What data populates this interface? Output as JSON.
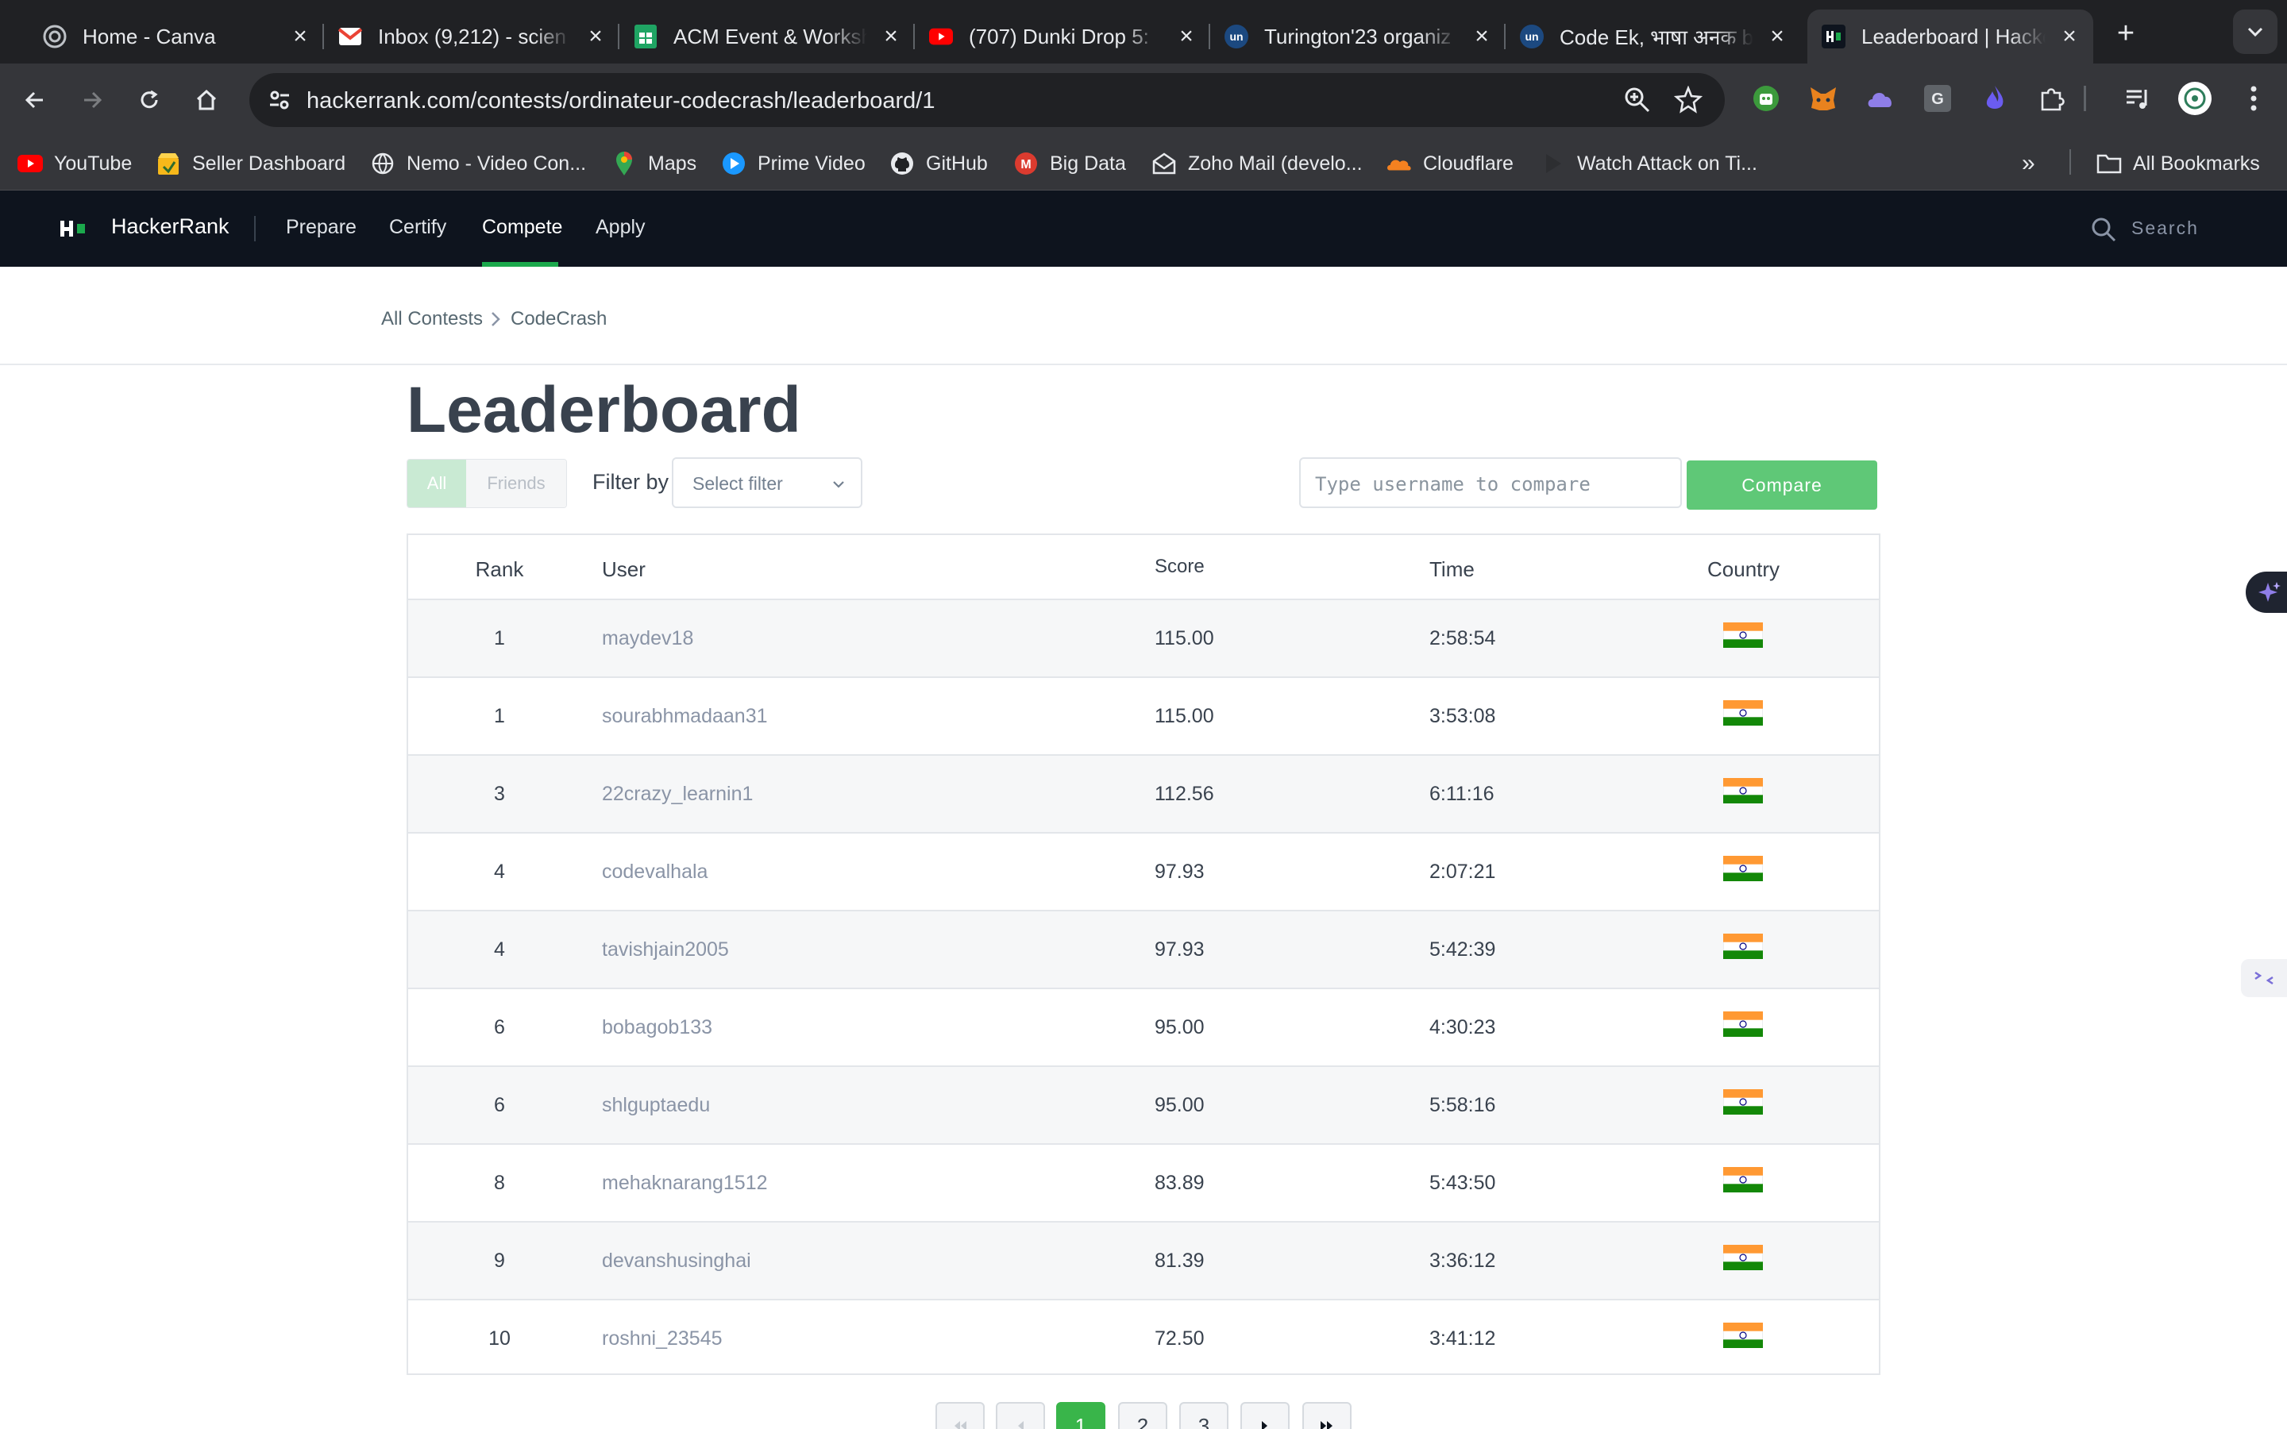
{
  "browser": {
    "tabs": [
      {
        "title": "Home - Canva",
        "icon": "canva-icon"
      },
      {
        "title": "Inbox (9,212) - scien",
        "icon": "gmail-icon"
      },
      {
        "title": "ACM Event & Worksh",
        "icon": "sheets-icon"
      },
      {
        "title": "(707) Dunki Drop 5:",
        "icon": "youtube-icon"
      },
      {
        "title": "Turington'23 organiz",
        "icon": "unstop-icon"
      },
      {
        "title": "Code Ek, भाषा अनक b",
        "icon": "unstop-icon"
      },
      {
        "title": "Leaderboard | Hacke",
        "icon": "hackerrank-icon",
        "active": true
      }
    ],
    "url": "hackerrank.com/contests/ordinateur-codecrash/leaderboard/1",
    "bookmarks": [
      {
        "label": "YouTube",
        "icon": "youtube-icon"
      },
      {
        "label": "Seller Dashboard",
        "icon": "seller-icon"
      },
      {
        "label": "Nemo - Video Con...",
        "icon": "globe-icon"
      },
      {
        "label": "Maps",
        "icon": "maps-icon"
      },
      {
        "label": "Prime Video",
        "icon": "prime-icon"
      },
      {
        "label": "GitHub",
        "icon": "github-icon"
      },
      {
        "label": "Big Data",
        "icon": "bigdata-icon"
      },
      {
        "label": "Zoho Mail (develo...",
        "icon": "zoho-icon"
      },
      {
        "label": "Cloudflare",
        "icon": "cloudflare-icon"
      },
      {
        "label": "Watch Attack on Ti...",
        "icon": "play-icon"
      }
    ],
    "all_bookmarks": "All Bookmarks"
  },
  "hr_nav": {
    "brand": "HackerRank",
    "links": [
      "Prepare",
      "Certify",
      "Compete",
      "Apply"
    ],
    "active": "Compete",
    "search_placeholder": "Search"
  },
  "breadcrumb": [
    "All Contests",
    "CodeCrash"
  ],
  "page_title": "Leaderboard",
  "filters": {
    "toggle": [
      "All",
      "Friends"
    ],
    "filter_label": "Filter by",
    "select_value": "Select filter",
    "compare_placeholder": "Type username to compare",
    "compare_button": "Compare"
  },
  "table": {
    "headers": [
      "Rank",
      "User",
      "Score",
      "Time",
      "Country"
    ],
    "rows": [
      {
        "rank": "1",
        "user": "maydev18",
        "score": "115.00",
        "time": "2:58:54",
        "country": "india-flag"
      },
      {
        "rank": "1",
        "user": "sourabhmadaan31",
        "score": "115.00",
        "time": "3:53:08",
        "country": "india-flag"
      },
      {
        "rank": "3",
        "user": "22crazy_learnin1",
        "score": "112.56",
        "time": "6:11:16",
        "country": "india-flag"
      },
      {
        "rank": "4",
        "user": "codevalhala",
        "score": "97.93",
        "time": "2:07:21",
        "country": "india-flag"
      },
      {
        "rank": "4",
        "user": "tavishjain2005",
        "score": "97.93",
        "time": "5:42:39",
        "country": "india-flag"
      },
      {
        "rank": "6",
        "user": "bobagob133",
        "score": "95.00",
        "time": "4:30:23",
        "country": "india-flag"
      },
      {
        "rank": "6",
        "user": "shlguptaedu",
        "score": "95.00",
        "time": "5:58:16",
        "country": "india-flag"
      },
      {
        "rank": "8",
        "user": "mehaknarang1512",
        "score": "83.89",
        "time": "5:43:50",
        "country": "india-flag"
      },
      {
        "rank": "9",
        "user": "devanshusinghai",
        "score": "81.39",
        "time": "3:36:12",
        "country": "india-flag"
      },
      {
        "rank": "10",
        "user": "roshni_23545",
        "score": "72.50",
        "time": "3:41:12",
        "country": "india-flag"
      }
    ]
  },
  "pagination": {
    "pages": [
      "1",
      "2",
      "3"
    ],
    "current": "1"
  },
  "colors": {
    "accent": "#1ba94c",
    "compare": "#5fc877",
    "nav_bg": "#0e141e",
    "page_active": "#39b54a"
  }
}
